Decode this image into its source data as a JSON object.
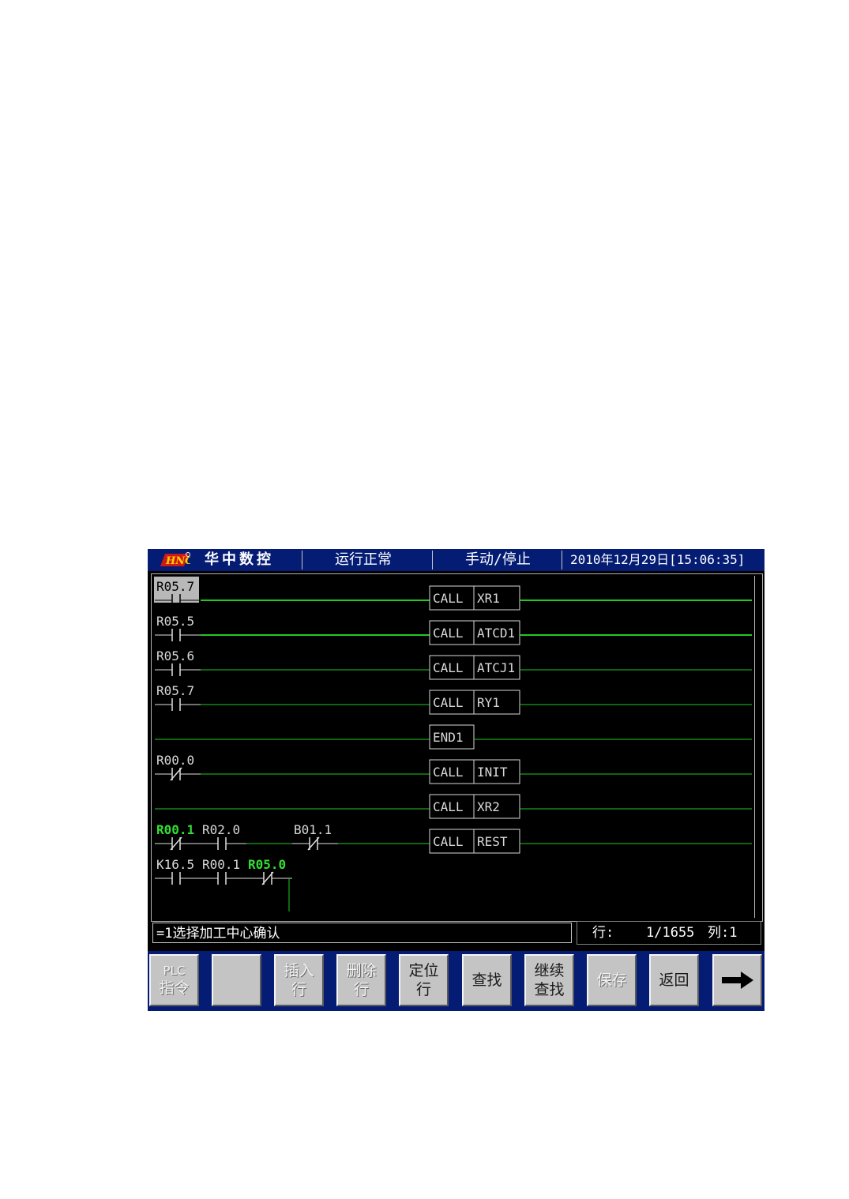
{
  "header": {
    "brand": "华中数控",
    "run_status": "运行正常",
    "mode": "手动/停止",
    "datetime": "2010年12月29日[15:06:35]"
  },
  "ladder": {
    "rungs": [
      {
        "contacts": [
          {
            "label": "R05.7",
            "type": "NO",
            "selected": true
          }
        ],
        "coil": {
          "op": "CALL",
          "arg": "XR1"
        }
      },
      {
        "contacts": [
          {
            "label": "R05.5",
            "type": "NO"
          }
        ],
        "coil": {
          "op": "CALL",
          "arg": "ATCD1"
        }
      },
      {
        "contacts": [
          {
            "label": "R05.6",
            "type": "NO"
          }
        ],
        "coil": {
          "op": "CALL",
          "arg": "ATCJ1"
        }
      },
      {
        "contacts": [
          {
            "label": "R05.7",
            "type": "NO"
          }
        ],
        "coil": {
          "op": "CALL",
          "arg": "RY1"
        }
      },
      {
        "contacts": [],
        "coil": {
          "op": "END1",
          "arg": ""
        }
      },
      {
        "contacts": [
          {
            "label": "R00.0",
            "type": "NC"
          }
        ],
        "coil": {
          "op": "CALL",
          "arg": "INIT"
        }
      },
      {
        "contacts": [],
        "coil": {
          "op": "CALL",
          "arg": "XR2"
        }
      },
      {
        "contacts": [
          {
            "label": "R00.1",
            "type": "NC",
            "active": true
          },
          {
            "label": "R02.0",
            "type": "NO"
          },
          {
            "label": "B01.1",
            "type": "NC",
            "col": 3
          }
        ],
        "coil": {
          "op": "CALL",
          "arg": "REST"
        }
      },
      {
        "contacts": [
          {
            "label": "K16.5",
            "type": "NO"
          },
          {
            "label": "R00.1",
            "type": "NO"
          },
          {
            "label": "R05.0",
            "type": "NC",
            "active": true
          }
        ],
        "coil": null
      }
    ]
  },
  "status": {
    "message": "=1选择加工中心确认",
    "row_label": "行:",
    "row_value": "1/1655",
    "col_label": "列:1"
  },
  "function_keys": [
    {
      "lines": [
        "PLC",
        "指令"
      ],
      "dim": true,
      "small_first": true
    },
    {
      "lines": [],
      "dim": true
    },
    {
      "lines": [
        "插入",
        "行"
      ],
      "dim": true
    },
    {
      "lines": [
        "删除",
        "行"
      ],
      "dim": true
    },
    {
      "lines": [
        "定位",
        "行"
      ],
      "dim": false
    },
    {
      "lines": [
        "查找"
      ],
      "dim": false
    },
    {
      "lines": [
        "继续",
        "查找"
      ],
      "dim": false
    },
    {
      "lines": [
        "保存"
      ],
      "dim": true
    },
    {
      "lines": [
        "返回"
      ],
      "dim": false
    },
    {
      "lines": [],
      "icon": "arrow-right-icon",
      "dim": false
    }
  ],
  "colors": {
    "header_bg": "#041c74",
    "ladder_line": "#22c822",
    "active_text": "#33dd33",
    "text": "#d8d8d8"
  }
}
